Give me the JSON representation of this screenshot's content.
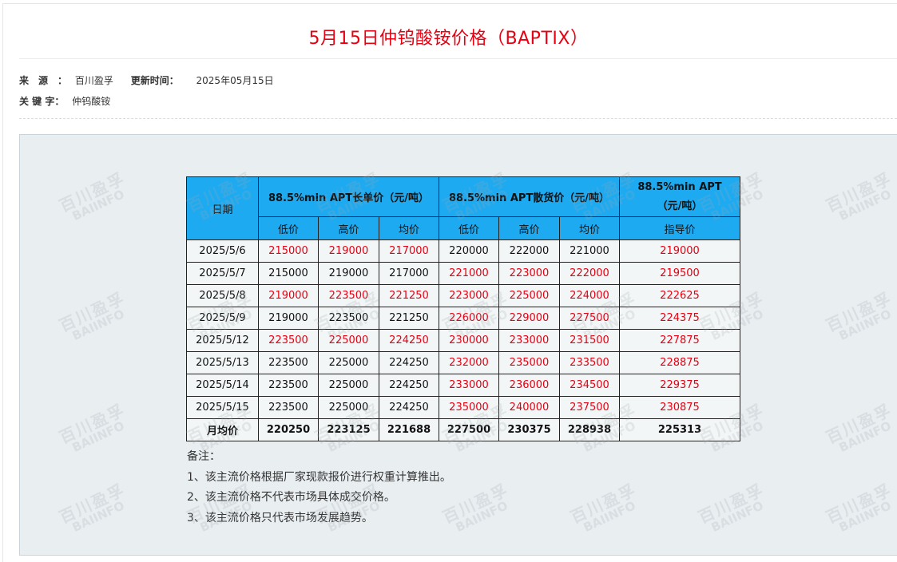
{
  "page": {
    "title": "5月15日仲钨酸铵价格（BAPTIX）",
    "source_label": "来　源　：",
    "source_value": "百川盈孚",
    "update_label": "更新时间：",
    "update_value": "2025年05月15日",
    "keyword_label": "关 键 字：",
    "keyword_value": "仲钨酸铵"
  },
  "colors": {
    "title": "#e60012",
    "header_bg": "#1eaaf1",
    "up": "#e60012"
  },
  "watermark": {
    "cn": "百川盈孚",
    "en": "BAIINFO"
  },
  "table": {
    "date_header": "日期",
    "groups": [
      "88.5%min APT长单价（元/吨）",
      "88.5%min APT散货价（元/吨）",
      "88.5%min APT（元/吨）"
    ],
    "subheaders": [
      "低价",
      "高价",
      "均价",
      "低价",
      "高价",
      "均价",
      "指导价"
    ],
    "rows": [
      {
        "date": "2025/5/6",
        "cells": [
          "215000",
          "219000",
          "217000",
          "220000",
          "222000",
          "221000",
          "219000"
        ],
        "red": [
          1,
          1,
          1,
          0,
          0,
          0,
          1
        ]
      },
      {
        "date": "2025/5/7",
        "cells": [
          "215000",
          "219000",
          "217000",
          "221000",
          "223000",
          "222000",
          "219500"
        ],
        "red": [
          0,
          0,
          0,
          1,
          1,
          1,
          1
        ]
      },
      {
        "date": "2025/5/8",
        "cells": [
          "219000",
          "223500",
          "221250",
          "223000",
          "225000",
          "224000",
          "222625"
        ],
        "red": [
          1,
          1,
          1,
          1,
          1,
          1,
          1
        ]
      },
      {
        "date": "2025/5/9",
        "cells": [
          "219000",
          "223500",
          "221250",
          "226000",
          "229000",
          "227500",
          "224375"
        ],
        "red": [
          0,
          0,
          0,
          1,
          1,
          1,
          1
        ]
      },
      {
        "date": "2025/5/12",
        "cells": [
          "223500",
          "225000",
          "224250",
          "230000",
          "233000",
          "231500",
          "227875"
        ],
        "red": [
          1,
          1,
          1,
          1,
          1,
          1,
          1
        ]
      },
      {
        "date": "2025/5/13",
        "cells": [
          "223500",
          "225000",
          "224250",
          "232000",
          "235000",
          "233500",
          "228875"
        ],
        "red": [
          0,
          0,
          0,
          1,
          1,
          1,
          1
        ]
      },
      {
        "date": "2025/5/14",
        "cells": [
          "223500",
          "225000",
          "224250",
          "233000",
          "236000",
          "234500",
          "229375"
        ],
        "red": [
          0,
          0,
          0,
          1,
          1,
          1,
          1
        ]
      },
      {
        "date": "2025/5/15",
        "cells": [
          "223500",
          "225000",
          "224250",
          "235000",
          "240000",
          "237500",
          "230875"
        ],
        "red": [
          0,
          0,
          0,
          1,
          1,
          1,
          1
        ]
      }
    ],
    "avg_label": "月均价",
    "avg_cells": [
      "220250",
      "223125",
      "221688",
      "227500",
      "230375",
      "228938",
      "225313"
    ]
  },
  "notes": {
    "heading": "备注：",
    "items": [
      "1、该主流价格根据厂家现款报价进行权重计算推出。",
      "2、该主流价格不代表市场具体成交价格。",
      "3、该主流价格只代表市场发展趋势。"
    ]
  }
}
